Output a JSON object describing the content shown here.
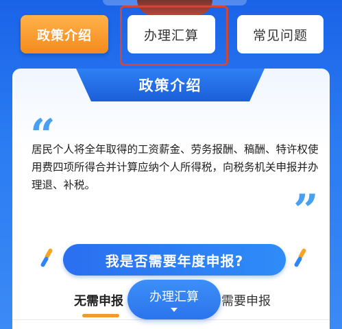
{
  "tabs": [
    {
      "label": "政策介绍",
      "active": true
    },
    {
      "label": "办理汇算",
      "active": false
    },
    {
      "label": "常见问题",
      "active": false
    }
  ],
  "section": {
    "banner_title": "政策介绍",
    "quote_open": "“",
    "quote_close": "”",
    "text": "居民个人将全年取得的工资薪金、劳务报酬、稿酬、特许权使用费四项所得合并计算应纳个人所得税，向税务机关申报并办理退、补税。"
  },
  "question": {
    "label": "我是否需要年度申报?"
  },
  "sub_tabs": [
    {
      "label": "无需申报",
      "active": true
    },
    {
      "label": "需要申报",
      "active": false
    }
  ],
  "float_button": {
    "label": "办理汇算"
  },
  "colors": {
    "accent_orange": "#f48a1c",
    "primary_blue": "#2a74ec",
    "highlight_red": "#d0473a"
  }
}
